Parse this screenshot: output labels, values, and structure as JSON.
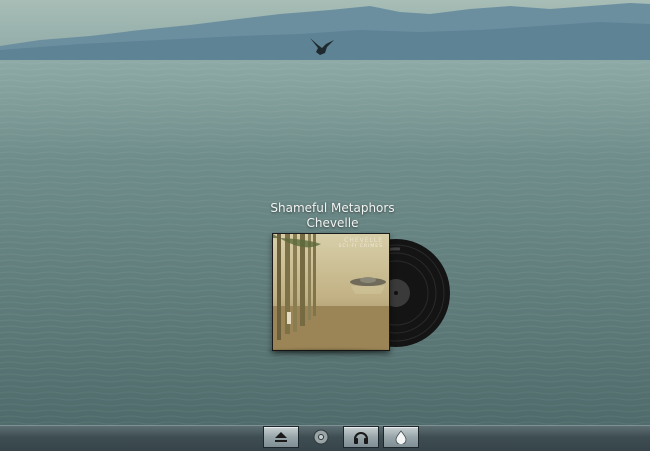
{
  "now_playing": {
    "track": "Shameful Metaphors",
    "artist": "Chevelle"
  },
  "album_cover": {
    "brand_text": "CHEVELLE",
    "album_text": "SCI-FI CRIMES"
  },
  "taskbar": {
    "buttons": [
      {
        "icon": "eject-icon"
      },
      {
        "icon": "chrome-icon"
      },
      {
        "icon": "headphones-icon"
      },
      {
        "icon": "water-drop-icon"
      }
    ]
  },
  "colors": {
    "sky": "#9fb7b1",
    "water": "#5c7a79",
    "taskbar": "#3e4d52"
  }
}
